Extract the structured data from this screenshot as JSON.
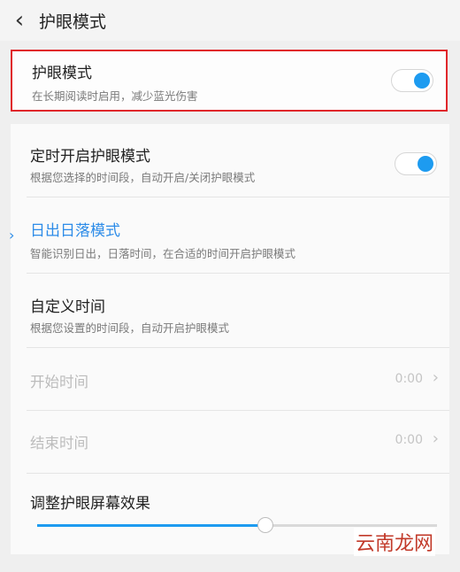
{
  "header": {
    "back_icon": "chevron-left-icon",
    "title": "护眼模式"
  },
  "eye_care": {
    "title": "护眼模式",
    "subtitle": "在长期阅读时启用，减少蓝光伤害",
    "enabled": true
  },
  "scheduled": {
    "title": "定时开启护眼模式",
    "subtitle": "根据您选择的时间段，自动开启/关闭护眼模式",
    "enabled": true
  },
  "sunrise_sunset": {
    "title": "日出日落模式",
    "subtitle": "智能识别日出，日落时间，在合适的时间开启护眼模式",
    "selected": true
  },
  "custom_time": {
    "title": "自定义时间",
    "subtitle": "根据您设置的时间段，自动开启护眼模式"
  },
  "start_time": {
    "label": "开始时间",
    "value": "0:00"
  },
  "end_time": {
    "label": "结束时间",
    "value": "0:00"
  },
  "effect": {
    "title": "调整护眼屏幕效果",
    "level": 0.57
  },
  "watermark": "云南龙网",
  "colors": {
    "accent": "#1d9bf0",
    "highlight_border": "#e0262b",
    "link_blue": "#2d8ce8"
  }
}
